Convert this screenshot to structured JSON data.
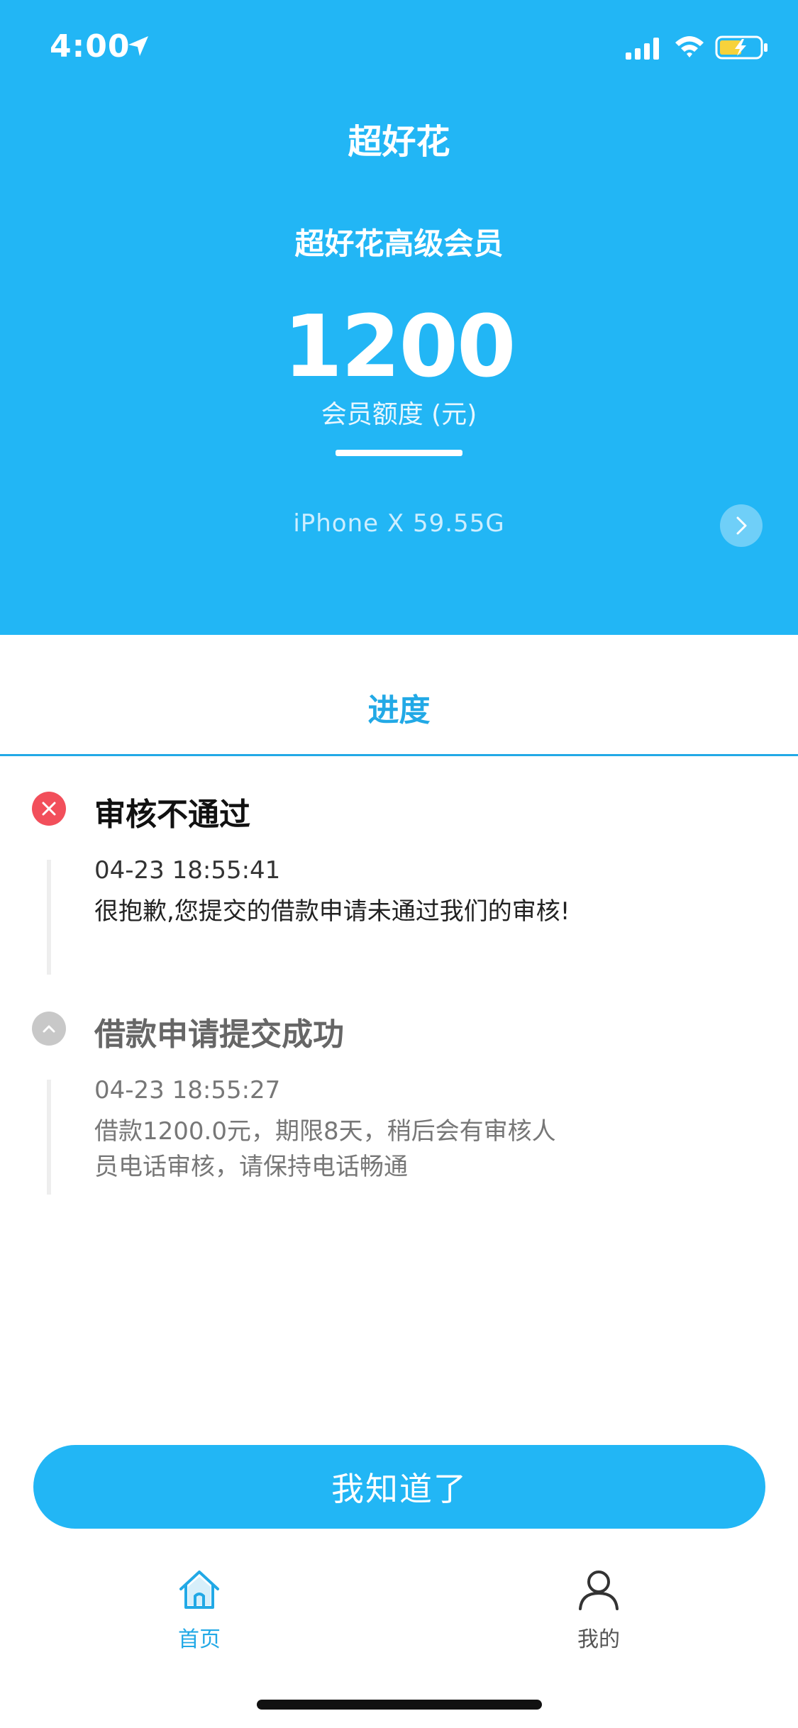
{
  "status_bar": {
    "time": "4:00"
  },
  "header": {
    "app_title": "超好花",
    "member_title": "超好花高级会员",
    "credit_amount": "1200",
    "credit_label": "会员额度 (元)",
    "device_info": "iPhone X  59.55G"
  },
  "tab": {
    "label": "进度"
  },
  "steps": [
    {
      "title": "审核不通过",
      "status": "failed",
      "time": "04-23 18:55:41",
      "message": "很抱歉,您提交的借款申请未通过我们的审核!"
    },
    {
      "title": "借款申请提交成功",
      "status": "done",
      "time": "04-23 18:55:27",
      "message": "借款1200.0元，期限8天，稍后会有审核人员电话审核，请保持电话畅通"
    }
  ],
  "ack_button": "我知道了",
  "bottom_nav": [
    {
      "label": "首页",
      "icon": "home-icon",
      "active": true
    },
    {
      "label": "我的",
      "icon": "user-icon",
      "active": false
    }
  ],
  "colors": {
    "primary": "#22b6f5",
    "tab_active": "#22a9e6",
    "error": "#f24f5b",
    "muted": "#c8c8c8"
  }
}
